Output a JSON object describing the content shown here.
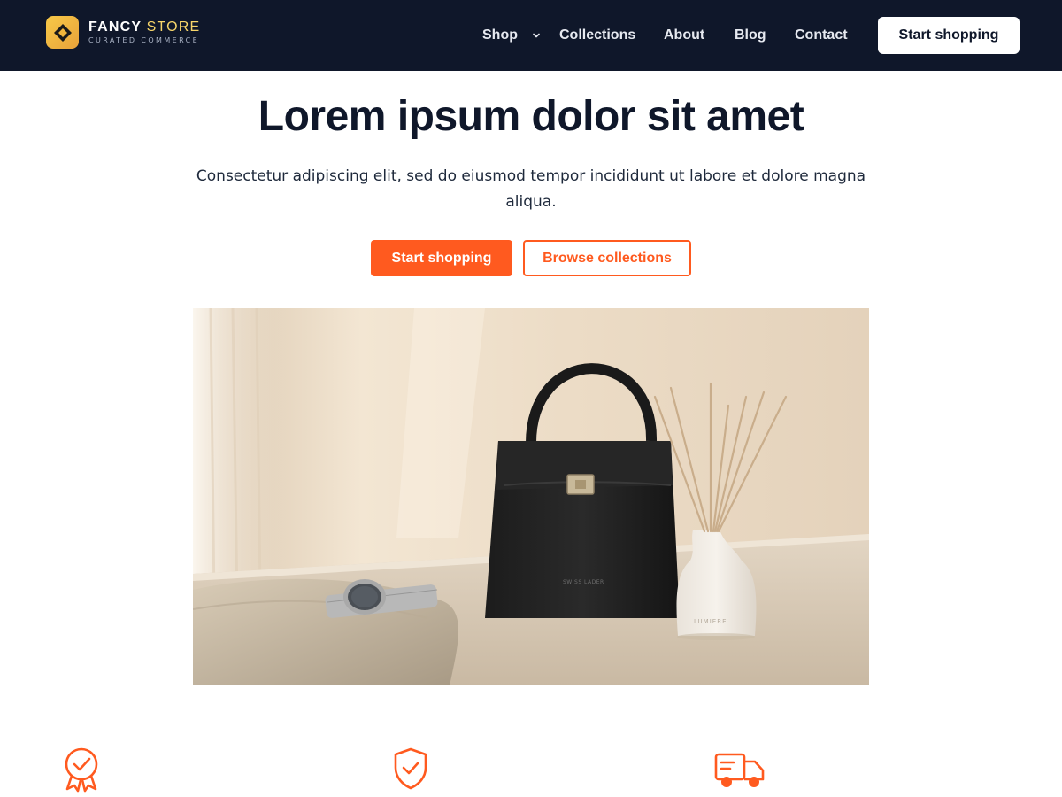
{
  "header": {
    "brand": {
      "name_part1": "FANCY",
      "name_part2": "STORE",
      "tagline": "CURATED COMMERCE",
      "logo_icon": "diamond-logo-icon",
      "logo_color": "#f2b53b"
    },
    "nav": [
      {
        "label": "Shop",
        "has_dropdown": true
      },
      {
        "label": "Collections"
      },
      {
        "label": "About"
      },
      {
        "label": "Blog"
      },
      {
        "label": "Contact"
      }
    ],
    "cta_label": "Start shopping",
    "background": "#0f172a"
  },
  "hero": {
    "title": "Lorem ipsum dolor sit amet",
    "subtitle": "Consectetur adipiscing elit, sed do eiusmod tempor incididunt ut labore et dolore magna aliqua.",
    "primary_button": "Start shopping",
    "secondary_button": "Browse collections",
    "image": {
      "bag_text": "SWISS LADER",
      "vase_text": "LUMIERE"
    }
  },
  "features": {
    "icons": [
      "award-ribbon-icon",
      "shield-check-icon",
      "delivery-truck-icon"
    ]
  },
  "colors": {
    "accent": "#ff5a1f",
    "dark": "#0f172a",
    "brand_gold": "#f7d56a"
  }
}
